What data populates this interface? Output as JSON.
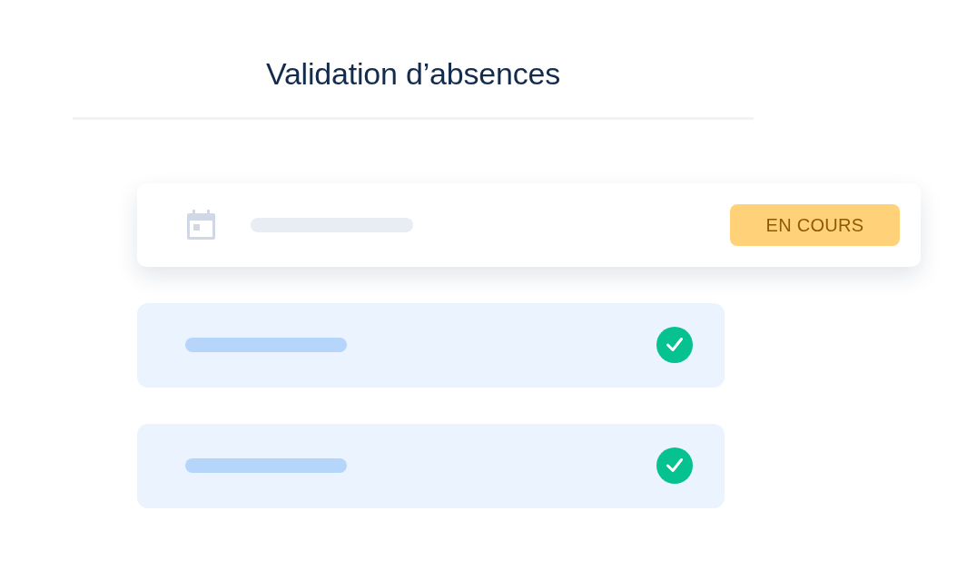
{
  "title": "Validation d’absences",
  "requests": [
    {
      "kind": "pending",
      "badge": "EN COURS"
    },
    {
      "kind": "approved"
    },
    {
      "kind": "approved"
    }
  ]
}
